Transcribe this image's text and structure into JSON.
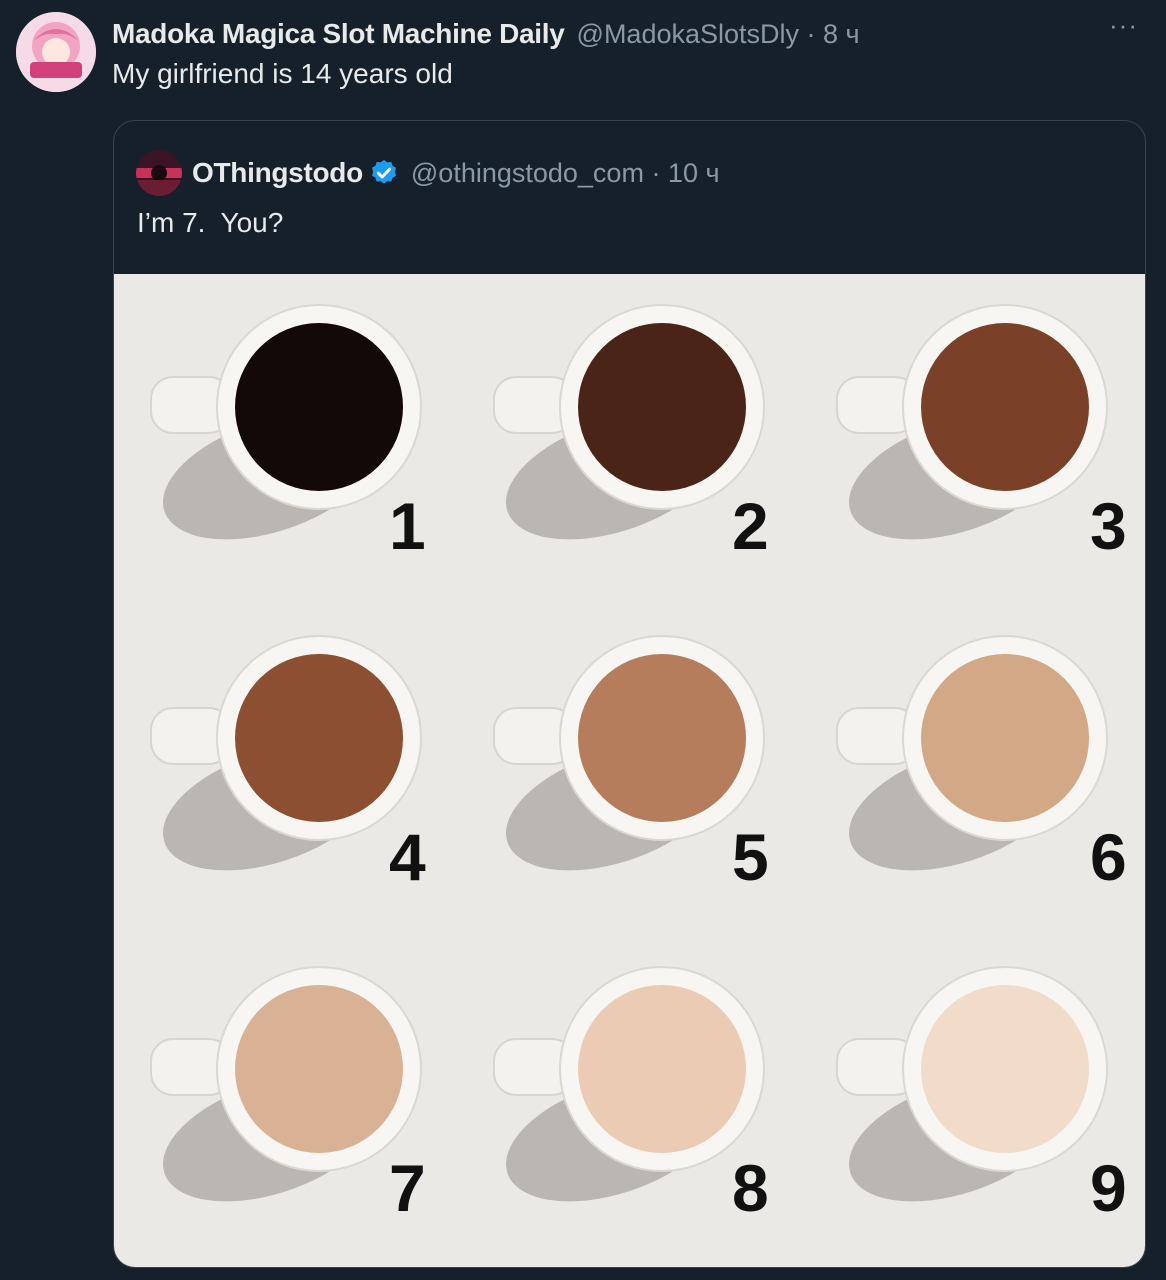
{
  "tweet": {
    "display_name": "Madoka Magica Slot Machine Daily",
    "handle_time": "@MadokaSlotsDly · 8 ч",
    "more_label": "···",
    "text": "My girlfriend is 14 years old"
  },
  "quoted_tweet": {
    "display_name": "OThingstodo",
    "handle_time": "@othingstodo_com · 10 ч",
    "text": "I’m 7.  You?",
    "verified_color": "#1d9bf0"
  },
  "media": {
    "cups": [
      {
        "label": "1",
        "color": "#130a08"
      },
      {
        "label": "2",
        "color": "#4a2517"
      },
      {
        "label": "3",
        "color": "#7a4028"
      },
      {
        "label": "4",
        "color": "#8c4f32"
      },
      {
        "label": "5",
        "color": "#b57d5c"
      },
      {
        "label": "6",
        "color": "#d2a886"
      },
      {
        "label": "7",
        "color": "#d9b195"
      },
      {
        "label": "8",
        "color": "#ebcbb4"
      },
      {
        "label": "9",
        "color": "#f0dcc9"
      }
    ]
  },
  "colors": {
    "background": "#15202b",
    "border": "#38444d",
    "secondary_text": "#8b98a5"
  }
}
